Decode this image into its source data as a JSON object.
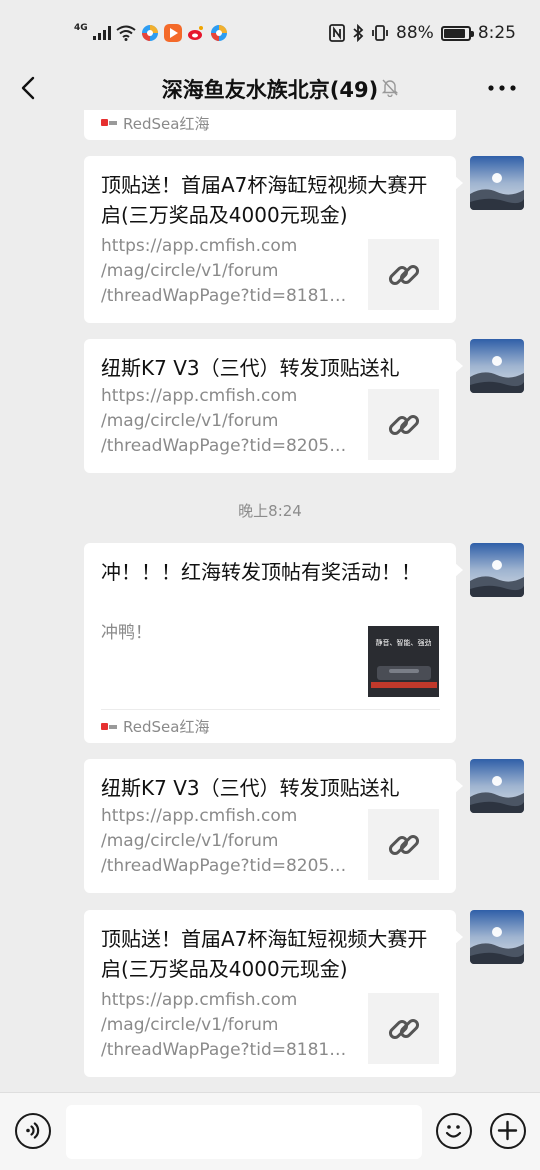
{
  "status_bar": {
    "network": "4G",
    "battery": "88%",
    "time": "8:25",
    "battery_level": 0.88
  },
  "nav": {
    "title": "深海鱼友水族北京(49)"
  },
  "partial_top": {
    "source": "RedSea红海"
  },
  "messages": [
    {
      "title": "顶贴送！首届A7杯海缸短视频大赛开启(三万奖品及4000元现金)",
      "desc_lines": [
        "https://app.cmfish.com",
        "/mag/circle/v1/forum",
        "/threadWapPage?tid=81816..."
      ]
    },
    {
      "title": "纽斯K7 V3（三代）转发顶贴送礼",
      "desc_lines": [
        "https://app.cmfish.com",
        "/mag/circle/v1/forum",
        "/threadWapPage?tid=82059..."
      ]
    },
    {
      "title": "冲！！！红海转发顶帖有奖活动！！",
      "desc": "冲鸭！",
      "source": "RedSea红海",
      "thumb_text": "静音、智能、强劲"
    },
    {
      "title": "纽斯K7 V3（三代）转发顶贴送礼",
      "desc_lines": [
        "https://app.cmfish.com",
        "/mag/circle/v1/forum",
        "/threadWapPage?tid=82059..."
      ]
    },
    {
      "title": "顶贴送！首届A7杯海缸短视频大赛开启(三万奖品及4000元现金)",
      "desc_lines": [
        "https://app.cmfish.com",
        "/mag/circle/v1/forum",
        "/threadWapPage?tid=81816..."
      ]
    }
  ],
  "timestamp": "晚上8:24",
  "colors": {
    "background": "#ededed",
    "bubble": "#ffffff",
    "secondary_text": "#8a8a8a"
  }
}
